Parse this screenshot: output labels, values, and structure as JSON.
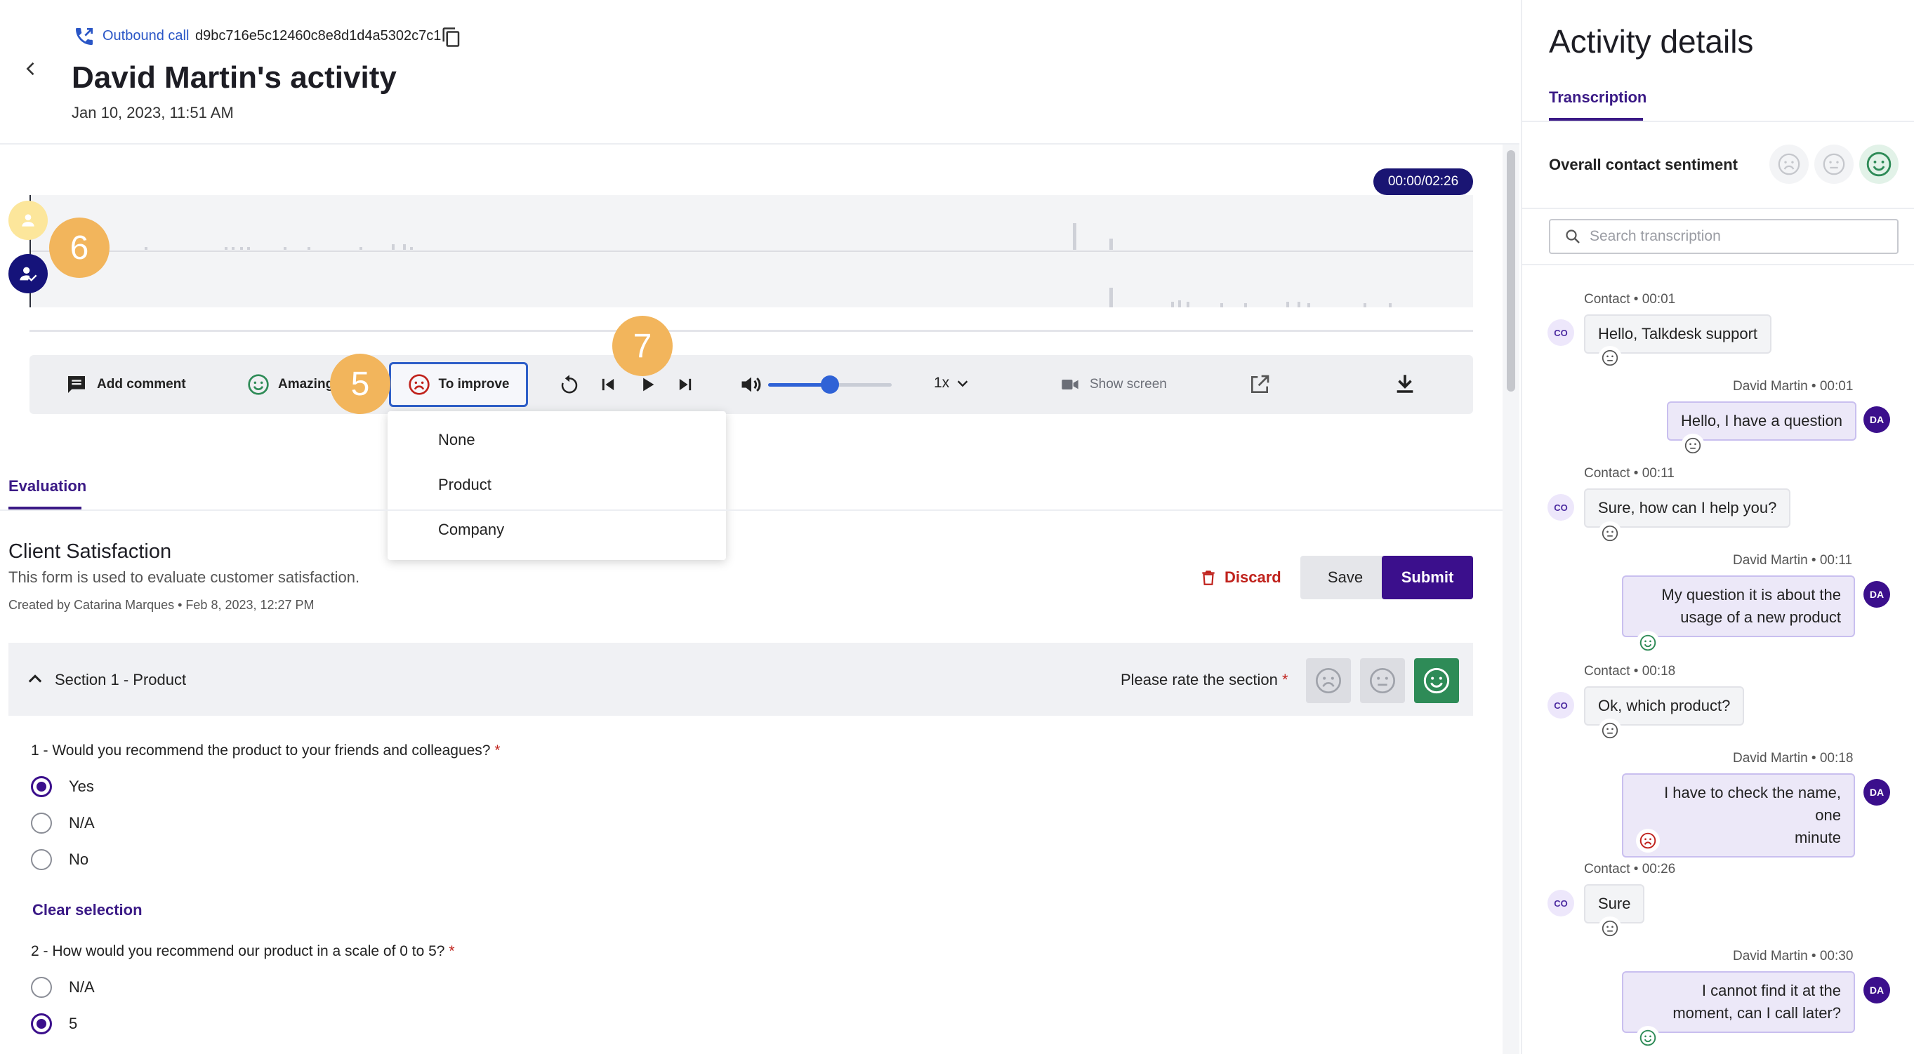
{
  "header": {
    "call_type": "Outbound call",
    "call_id": "d9bc716e5c12460c8e8d1d4a5302c7c1",
    "title": "David Martin's activity",
    "date": "Jan 10, 2023, 11:51 AM"
  },
  "player": {
    "time": "00:00/02:26",
    "speed": "1x",
    "volume_percent": 50
  },
  "toolbar": {
    "add_comment": "Add comment",
    "amazing": "Amazing",
    "to_improve": "To improve",
    "show_screen": "Show screen"
  },
  "steps": {
    "five": "5",
    "six": "6",
    "seven": "7"
  },
  "dropdown": {
    "options": [
      "None",
      "Product",
      "Company"
    ]
  },
  "evaluation": {
    "tab": "Evaluation",
    "form_title": "Client Satisfaction",
    "form_desc": "This form is used to evaluate customer satisfaction.",
    "created": "Created by Catarina Marques • Feb 8, 2023, 12:27 PM",
    "discard": "Discard",
    "save": "Save",
    "submit": "Submit",
    "section_title": "Section 1 - Product",
    "rate_label": "Please rate the section",
    "required_mark": "*",
    "q1": "1 - Would you recommend the product to your friends and colleagues?",
    "q1_options": [
      "Yes",
      "N/A",
      "No"
    ],
    "clear_selection": "Clear selection",
    "q2": "2 - How would you recommend our product in a scale of 0 to 5?",
    "q2_options": [
      "N/A",
      "5"
    ]
  },
  "panel": {
    "title": "Activity details",
    "tab": "Transcription",
    "sentiment_label": "Overall contact sentiment",
    "search_placeholder": "Search transcription",
    "messages": [
      {
        "who": "Contact • 00:01",
        "text": "Hello, Talkdesk support",
        "av": "CO"
      },
      {
        "who": "David Martin • 00:01",
        "text": "Hello, I have a question",
        "av": "DA"
      },
      {
        "who": "Contact • 00:11",
        "text": "Sure, how can I help you?",
        "av": "CO"
      },
      {
        "who": "David Martin • 00:11",
        "text1": "My question it is about the",
        "text2": "usage of a new product",
        "av": "DA"
      },
      {
        "who": "Contact • 00:18",
        "text": "Ok, which product?",
        "av": "CO"
      },
      {
        "who": "David Martin • 00:18",
        "text1": "I have to check the name, one",
        "text2": "minute",
        "av": "DA"
      },
      {
        "who": "Contact • 00:26",
        "text": "Sure",
        "av": "CO"
      },
      {
        "who": "David Martin • 00:30",
        "text1": "I cannot find it at the",
        "text2": "moment, can I call later?",
        "av": "DA"
      }
    ]
  },
  "colors": {
    "primary": "#3b0f8c",
    "accent_blue": "#2f62d6",
    "danger": "#c0221c",
    "positive": "#2e8b57",
    "badge": "#f2b55c"
  }
}
